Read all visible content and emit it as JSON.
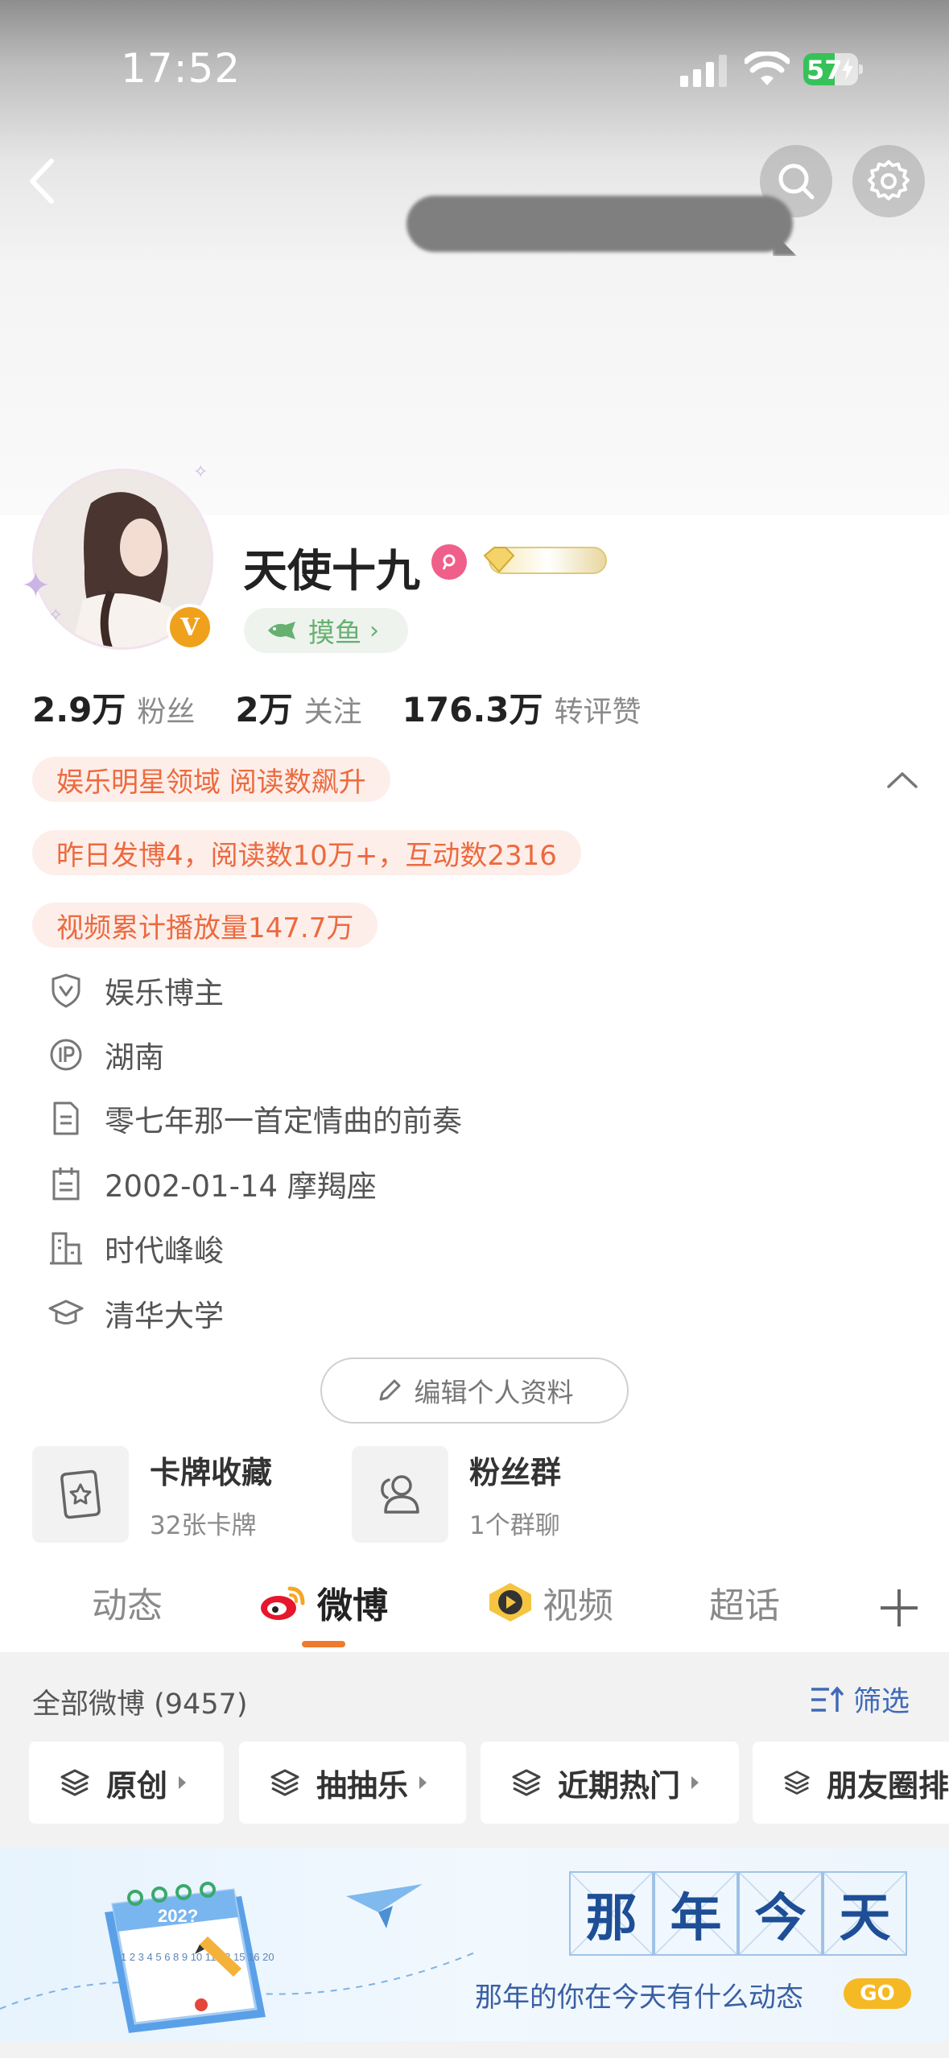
{
  "status_bar": {
    "time": "17:52",
    "battery": "57",
    "battery_level": 0.57
  },
  "profile": {
    "username": "天使十九",
    "tag_label": "摸鱼",
    "stats": [
      {
        "num": "2.9万",
        "label": "粉丝"
      },
      {
        "num": "2万",
        "label": "关注"
      },
      {
        "num": "176.3万",
        "label": "转评赞"
      }
    ],
    "highlights": [
      "娱乐明星领域 阅读数飙升",
      "昨日发博4，阅读数10万+，互动数2316",
      "视频累计播放量147.7万"
    ],
    "info": [
      {
        "icon": "verified-shield-icon",
        "text": "娱乐博主"
      },
      {
        "icon": "ip-location-icon",
        "text": "湖南"
      },
      {
        "icon": "bio-document-icon",
        "text": "零七年那一首定情曲的前奏"
      },
      {
        "icon": "birthday-calendar-icon",
        "text": "2002-01-14 摩羯座"
      },
      {
        "icon": "company-building-icon",
        "text": "时代峰峻"
      },
      {
        "icon": "school-cap-icon",
        "text": "清华大学"
      }
    ],
    "edit_label": "编辑个人资料"
  },
  "cards": [
    {
      "title": "卡牌收藏",
      "sub": "32张卡牌",
      "icon": "card-collection-icon"
    },
    {
      "title": "粉丝群",
      "sub": "1个群聊",
      "icon": "fan-group-icon"
    }
  ],
  "tabs": {
    "items": [
      {
        "label": "动态"
      },
      {
        "label": "微博"
      },
      {
        "label": "视频"
      },
      {
        "label": "超话"
      }
    ],
    "active": "微博",
    "add_icon": "plus-icon"
  },
  "feed": {
    "all_label": "全部微博 (9457)",
    "filter_label": "筛选",
    "chips": [
      "原创",
      "抽抽乐",
      "近期热门",
      "朋友圈排"
    ]
  },
  "banner": {
    "chars": [
      "那",
      "年",
      "今",
      "天"
    ],
    "subtitle": "那年的你在今天有什么动态",
    "go": "GO",
    "calendar_year": "202?",
    "calendar_digits": "1 2 3 4 5 6 8 9 10 11 12 15 16 20"
  },
  "colors": {
    "accent_orange": "#F07A2C",
    "highlight_text": "#EC6A3F",
    "highlight_bg": "#FDEEE9",
    "link_blue": "#3F6AB8",
    "battery_green": "#37C259"
  }
}
